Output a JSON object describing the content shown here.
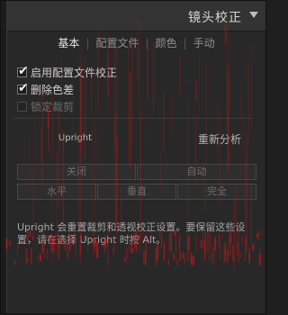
{
  "panel": {
    "title": "镜头校正",
    "collapse_icon": "triangle-down-icon"
  },
  "tabs": [
    {
      "label": "基本",
      "active": true
    },
    {
      "label": "配置文件",
      "active": false
    },
    {
      "label": "颜色",
      "active": false
    },
    {
      "label": "手动",
      "active": false
    }
  ],
  "options": [
    {
      "label": "启用配置文件校正",
      "checked": true,
      "enabled": true
    },
    {
      "label": "删除色差",
      "checked": true,
      "enabled": true
    },
    {
      "label": "锁定裁剪",
      "checked": false,
      "enabled": false
    }
  ],
  "upright": {
    "label": "Upright",
    "reanalyze_label": "重新分析",
    "buttons": {
      "off": "关闭",
      "auto": "自动",
      "level": "水平",
      "vertical": "垂直",
      "full": "完全"
    },
    "description": "Upright 会重置裁剪和透视校正设置。要保留这些设置，请在选择 Upright 时按 Alt。"
  },
  "colors": {
    "panel_bg": "#282828",
    "header_bg": "#333333",
    "artifact_red": "#c4161c"
  }
}
